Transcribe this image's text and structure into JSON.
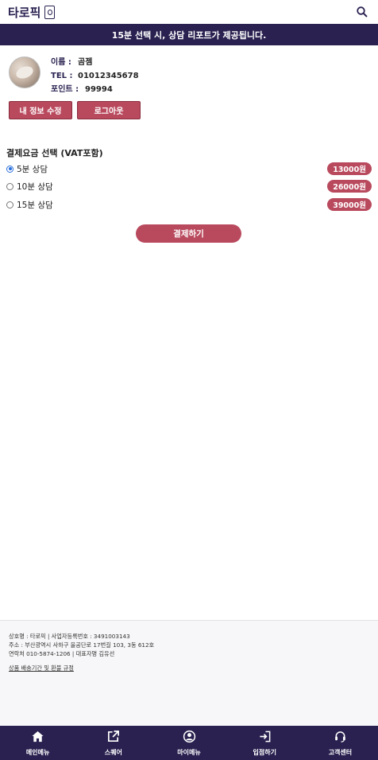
{
  "header": {
    "logo_text": "타로픽",
    "logo_icon": "tarot-card-icon",
    "search_icon": "search-icon"
  },
  "banner": {
    "text": "15분 선택 시, 상담 리포트가 제공됩니다."
  },
  "profile": {
    "name_label": "이름 :",
    "name_value": "곰젬",
    "tel_label": "TEL :",
    "tel_value": "01012345678",
    "point_label": "포인트 :",
    "point_value": "99994",
    "edit_button": "내 정보 수정",
    "logout_button": "로그아웃"
  },
  "payment": {
    "title": "결제요금 선택 (VAT포함)",
    "options": [
      {
        "label": "5분 상담",
        "price": "13000원",
        "selected": true
      },
      {
        "label": "10분 상담",
        "price": "26000원",
        "selected": false
      },
      {
        "label": "15분 상담",
        "price": "39000원",
        "selected": false
      }
    ],
    "pay_button": "결제하기"
  },
  "footer": {
    "line1": "상호명 : 타로픽 | 사업자등록번호 : 3491003143",
    "line2": "주소 : 부산광역시 사하구 을공단로 17번길 103, 3동 612호",
    "line3": "연락처 010-5874-1206 | 대표자명 김유선",
    "policy_link": "상품 배송기간 및 환불 규정"
  },
  "nav": {
    "items": [
      {
        "label": "메인메뉴",
        "icon": "home-icon"
      },
      {
        "label": "스퀘어",
        "icon": "external-link-icon"
      },
      {
        "label": "마이메뉴",
        "icon": "user-circle-icon"
      },
      {
        "label": "입점하기",
        "icon": "sign-in-icon"
      },
      {
        "label": "고객센터",
        "icon": "headset-icon"
      }
    ]
  },
  "colors": {
    "primary": "#2a2150",
    "accent": "#b94a5e",
    "radio_selected": "#2a6fdb"
  }
}
